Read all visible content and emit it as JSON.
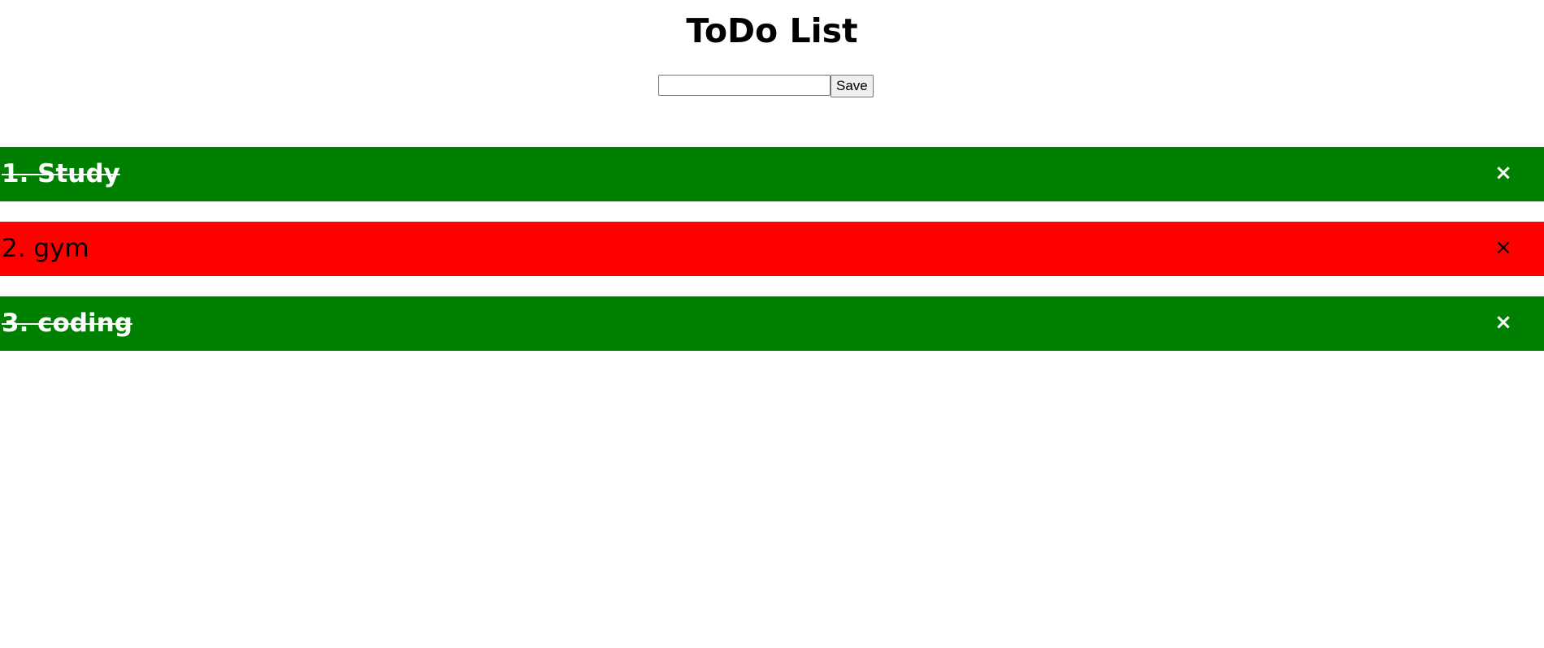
{
  "header": {
    "title": "ToDo List"
  },
  "form": {
    "input_value": "",
    "input_placeholder": "",
    "save_label": "Save"
  },
  "todos": [
    {
      "label": "1. Study",
      "status": "done",
      "color": "#008000",
      "delete_icon": "×"
    },
    {
      "label": "2. gym",
      "status": "pending",
      "color": "#ff0000",
      "delete_icon": "×"
    },
    {
      "label": "3. coding",
      "status": "done",
      "color": "#008000",
      "delete_icon": "×"
    }
  ],
  "colors": {
    "done": "#008000",
    "pending": "#ff0000",
    "done_text": "#ffffff",
    "pending_text": "#000000"
  }
}
